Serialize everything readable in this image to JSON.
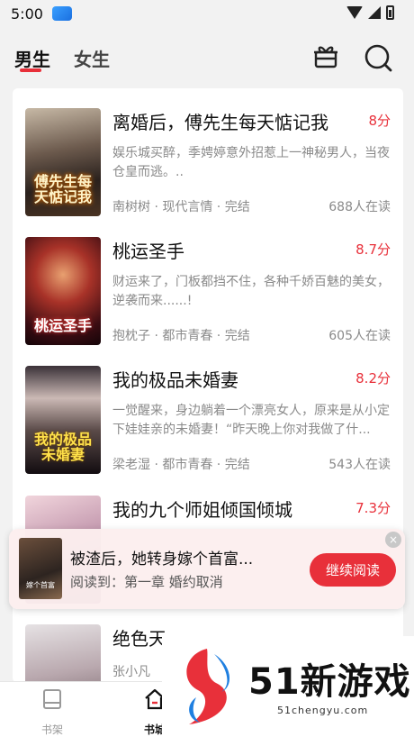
{
  "status_bar": {
    "time": "5:00"
  },
  "header": {
    "tabs": [
      {
        "label": "男生",
        "active": true
      },
      {
        "label": "女生",
        "active": false
      }
    ]
  },
  "books": [
    {
      "cover_title": "傅先生每天惦记我",
      "title": "离婚后，傅先生每天惦记我",
      "score": "8分",
      "description": "娱乐城买醉，季娉婷意外招惹上一神秘男人，当夜仓皇而逃。..",
      "meta": "南树树 · 现代言情 · 完结",
      "readers": "688人在读"
    },
    {
      "cover_title": "桃运圣手",
      "title": "桃运圣手",
      "score": "8.7分",
      "description": "财运来了，门板都挡不住，各种千娇百魅的美女，逆袭而来......!",
      "meta": "抱枕子 · 都市青春 · 完结",
      "readers": "605人在读"
    },
    {
      "cover_title": "我的极品未婚妻",
      "title": "我的极品未婚妻",
      "score": "8.2分",
      "description": "一觉醒来，身边躺着一个漂亮女人，原来是从小定下娃娃亲的未婚妻！“昨天晚上你对我做了什...",
      "meta": "梁老湿 · 都市青春 · 完结",
      "readers": "543人在读"
    },
    {
      "cover_title": "",
      "title": "我的九个师姐倾国倾城",
      "score": "7.3分",
      "description": "",
      "meta": "",
      "readers": ""
    },
    {
      "cover_title": "",
      "title": "绝色天",
      "score": "",
      "description": "",
      "meta": "张小凡",
      "readers": ""
    }
  ],
  "popup": {
    "cover_title": "嫁个首富",
    "title": "被渣后，她转身嫁个首富...",
    "progress": "阅读到：第一章 婚约取消",
    "button": "继续阅读",
    "close": "×"
  },
  "nav": {
    "items": [
      {
        "label": "书架",
        "icon": "bookshelf-icon"
      },
      {
        "label": "书城",
        "icon": "bookstore-icon"
      }
    ]
  },
  "watermark": {
    "title": "51新游戏",
    "url": "51chengyu.com"
  },
  "colors": {
    "accent": "#e8303a",
    "background": "#f2f2f2"
  }
}
